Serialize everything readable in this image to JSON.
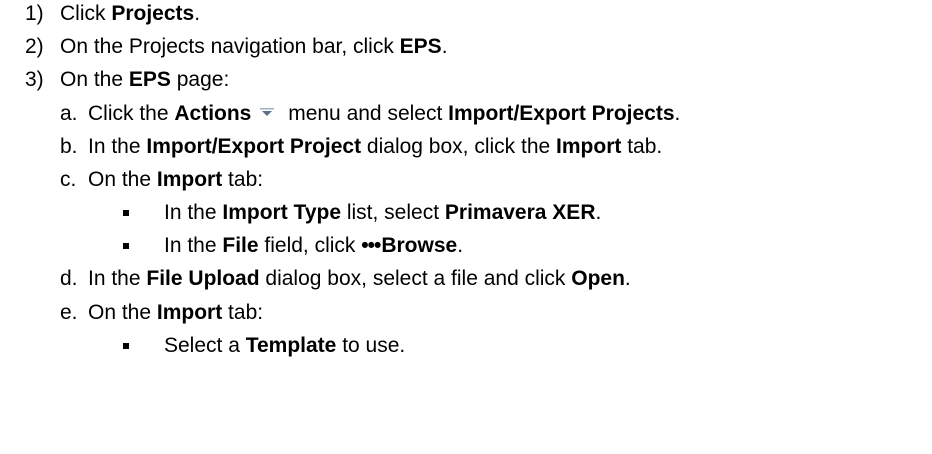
{
  "steps": [
    {
      "num": "1)",
      "pre": "Click ",
      "b1": "Projects",
      "post": "."
    },
    {
      "num": "2)",
      "pre": "On the Projects navigation bar, click ",
      "b1": "EPS",
      "post": "."
    },
    {
      "num": "3)",
      "pre": "On the ",
      "b1": "EPS",
      "post": " page:"
    }
  ],
  "substeps": {
    "a": {
      "letter": "a.",
      "pre": "Click the ",
      "b1": "Actions",
      "mid": " menu and select ",
      "b2": "Import/Export Projects",
      "post": "."
    },
    "b": {
      "letter": "b.",
      "pre": "In the ",
      "b1": "Import/Export Project",
      "mid": " dialog box, click the ",
      "b2": "Import",
      "post": " tab."
    },
    "c": {
      "letter": "c.",
      "pre": "On the ",
      "b1": "Import",
      "post": " tab:"
    },
    "c_bullets": [
      {
        "pre": "In the ",
        "b1": "Import Type",
        "mid": " list, select ",
        "b2": "Primavera XER",
        "post": "."
      },
      {
        "pre": "In the ",
        "b1": "File",
        "mid": " field, click ",
        "dots": "•••",
        "b2": "Browse",
        "post": "."
      }
    ],
    "d": {
      "letter": "d.",
      "pre": "In the ",
      "b1": "File Upload",
      "mid": " dialog box, select a file and click ",
      "b2": "Open",
      "post": "."
    },
    "e": {
      "letter": "e.",
      "pre": "On the ",
      "b1": "Import",
      "post": " tab:"
    },
    "e_bullets": [
      {
        "pre": "Select a ",
        "b1": "Template",
        "post": " to use."
      }
    ]
  },
  "icons": {
    "actions_menu": "dropdown-arrow-icon",
    "bullet": "square-bullet-icon",
    "browse": "ellipsis-icon"
  },
  "colors": {
    "text": "#000000",
    "arrow": "#5a6f8a"
  }
}
